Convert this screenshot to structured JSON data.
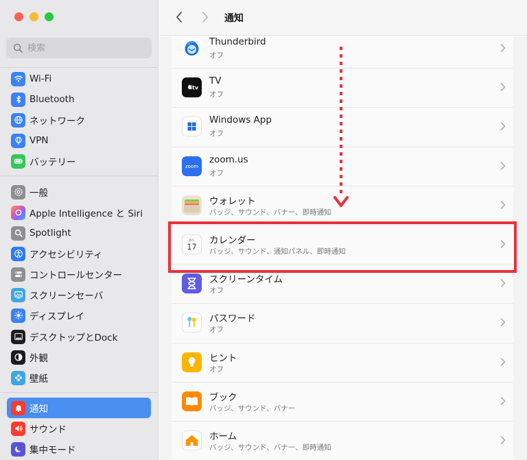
{
  "search": {
    "placeholder": "検索"
  },
  "sidebar": {
    "items": [
      {
        "label": "Wi-Fi",
        "icon": "wifi-icon",
        "color": "#3b82f6"
      },
      {
        "label": "Bluetooth",
        "icon": "bluetooth-icon",
        "color": "#3b82f6"
      },
      {
        "label": "ネットワーク",
        "icon": "globe-icon",
        "color": "#3b82f6"
      },
      {
        "label": "VPN",
        "icon": "vpn-globe-icon",
        "color": "#3b82f6"
      },
      {
        "label": "バッテリー",
        "icon": "battery-icon",
        "color": "#34c759"
      },
      {
        "label": "一般",
        "icon": "gear-icon",
        "color": "#8e8e93"
      },
      {
        "label": "Apple Intelligence と Siri",
        "icon": "siri-icon",
        "color": "#b58cf7"
      },
      {
        "label": "Spotlight",
        "icon": "magnifier-icon",
        "color": "#8e8e93"
      },
      {
        "label": "アクセシビリティ",
        "icon": "accessibility-icon",
        "color": "#2f7cf6"
      },
      {
        "label": "コントロールセンター",
        "icon": "toggles-icon",
        "color": "#8e8e93"
      },
      {
        "label": "スクリーンセーバ",
        "icon": "screensaver-icon",
        "color": "#3fa6e3"
      },
      {
        "label": "ディスプレイ",
        "icon": "sun-icon",
        "color": "#3b82f6"
      },
      {
        "label": "デスクトップとDock",
        "icon": "dock-icon",
        "color": "#1d1d1f"
      },
      {
        "label": "外観",
        "icon": "appearance-icon",
        "color": "#1d1d1f"
      },
      {
        "label": "壁紙",
        "icon": "flower-icon",
        "color": "#3fa6e3"
      },
      {
        "label": "通知",
        "icon": "bell-icon",
        "color": "#ff3b30"
      },
      {
        "label": "サウンド",
        "icon": "speaker-icon",
        "color": "#ff3b30"
      },
      {
        "label": "集中モード",
        "icon": "moon-icon",
        "color": "#5856d6"
      }
    ]
  },
  "header": {
    "title": "通知"
  },
  "apps": [
    {
      "name": "Thunderbird",
      "status": "オフ",
      "icon": "thunderbird-icon"
    },
    {
      "name": "TV",
      "status": "オフ",
      "icon": "apple-tv-icon"
    },
    {
      "name": "Windows App",
      "status": "オフ",
      "icon": "windows-icon"
    },
    {
      "name": "zoom.us",
      "status": "オフ",
      "icon": "zoom-icon"
    },
    {
      "name": "ウォレット",
      "status": "バッジ、サウンド、バナー、即時通知",
      "icon": "wallet-icon"
    },
    {
      "name": "カレンダー",
      "status": "バッジ、サウンド、通知パネル、即時通知",
      "icon": "calendar-icon"
    },
    {
      "name": "スクリーンタイム",
      "status": "オフ",
      "icon": "hourglass-icon"
    },
    {
      "name": "パスワード",
      "status": "オフ",
      "icon": "keys-icon"
    },
    {
      "name": "ヒント",
      "status": "オフ",
      "icon": "lightbulb-icon"
    },
    {
      "name": "ブック",
      "status": "バッジ、サウンド、バナー",
      "icon": "book-icon"
    },
    {
      "name": "ホーム",
      "status": "バッジ、サウンド、バナー、即時通知",
      "icon": "home-icon"
    }
  ],
  "calendar_icon": {
    "month": "JUL",
    "day": "17"
  },
  "tv_icon_label": "tv",
  "zoom_icon_label": "zoom",
  "colors": {
    "accent": "#4a8ff0",
    "highlight": "#e8323a"
  }
}
